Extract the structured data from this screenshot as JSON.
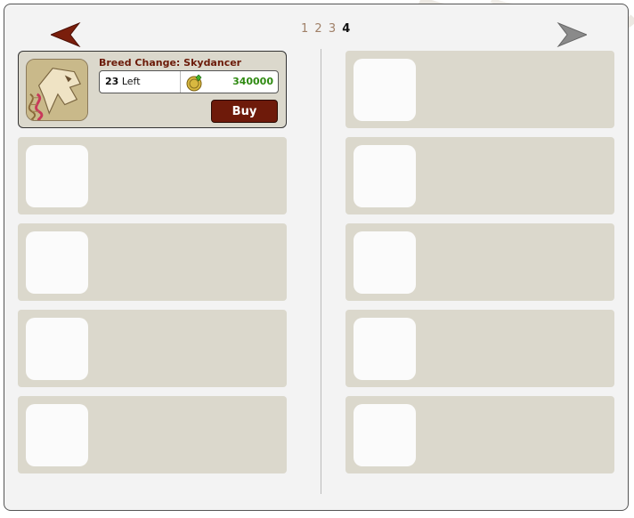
{
  "pager": {
    "pages": [
      "1",
      "2",
      "3",
      "4"
    ],
    "current": "4"
  },
  "nav": {
    "prev_icon": "left-arrow-icon",
    "next_icon": "right-arrow-icon",
    "prev_color": "#7a1e0c",
    "next_color": "#8a8a8a"
  },
  "item": {
    "title": "Breed Change: Skydancer",
    "stock_count": "23",
    "stock_suffix": "Left",
    "price": "340000",
    "currency_icon": "gem-coin-icon",
    "buy_label": "Buy",
    "icon": "skydancer-dragon-dna-icon"
  },
  "colors": {
    "panel_bg": "#f3f3f3",
    "slot_bg": "#dbd8cc",
    "title": "#6b1a08",
    "price": "#2f8a12",
    "buy_bg": "#6e1a0a"
  }
}
